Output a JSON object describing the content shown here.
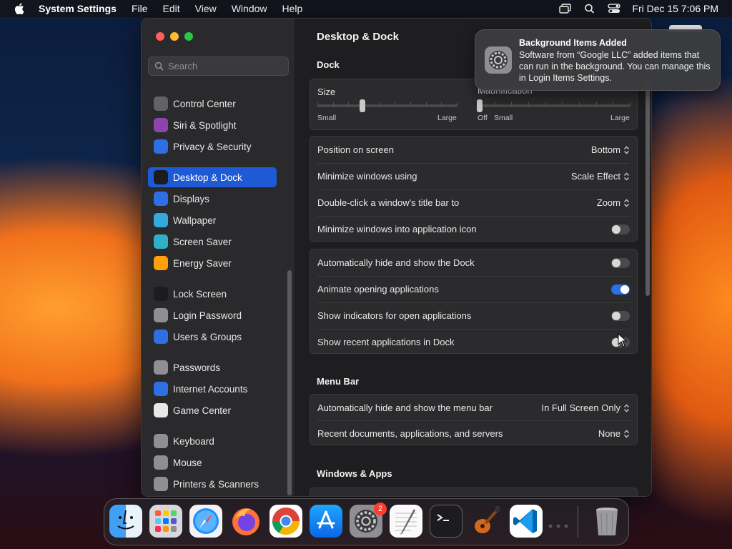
{
  "menubar": {
    "app_name": "System Settings",
    "menus": [
      "File",
      "Edit",
      "View",
      "Window",
      "Help"
    ],
    "clock": "Fri Dec 15  7:06 PM"
  },
  "sidebar": {
    "search_placeholder": "Search",
    "items": [
      {
        "label": "Control Center",
        "icon": "control-center-icon",
        "color": "#636366"
      },
      {
        "label": "Siri & Spotlight",
        "icon": "siri-icon",
        "color": "#8e44ad"
      },
      {
        "label": "Privacy & Security",
        "icon": "hand-icon",
        "color": "#2f6fe4"
      },
      {
        "label": "Desktop & Dock",
        "icon": "dock-icon",
        "color": "#1c1c1e",
        "active": true
      },
      {
        "label": "Displays",
        "icon": "sun-icon",
        "color": "#2f6fe4"
      },
      {
        "label": "Wallpaper",
        "icon": "flower-icon",
        "color": "#34aadc"
      },
      {
        "label": "Screen Saver",
        "icon": "screen-saver-icon",
        "color": "#30b0c7"
      },
      {
        "label": "Energy Saver",
        "icon": "bulb-icon",
        "color": "#ff9f0a"
      },
      {
        "label": "Lock Screen",
        "icon": "lock-icon",
        "color": "#1c1c1e"
      },
      {
        "label": "Login Password",
        "icon": "padlock-icon",
        "color": "#8e8e93"
      },
      {
        "label": "Users & Groups",
        "icon": "users-icon",
        "color": "#2f6fe4"
      },
      {
        "label": "Passwords",
        "icon": "key-icon",
        "color": "#8e8e93"
      },
      {
        "label": "Internet Accounts",
        "icon": "at-icon",
        "color": "#2f6fe4"
      },
      {
        "label": "Game Center",
        "icon": "game-center-icon",
        "color": "#e8e8e8"
      },
      {
        "label": "Keyboard",
        "icon": "keyboard-icon",
        "color": "#8e8e93"
      },
      {
        "label": "Mouse",
        "icon": "mouse-icon",
        "color": "#8e8e93"
      },
      {
        "label": "Printers & Scanners",
        "icon": "printer-icon",
        "color": "#8e8e93"
      }
    ]
  },
  "main": {
    "title": "Desktop & Dock",
    "dock_section": "Dock",
    "size_label": "Size",
    "size_small": "Small",
    "size_large": "Large",
    "size_level": 0.32,
    "magnification_label": "Magnification",
    "mag_off": "Off",
    "mag_small": "Small",
    "mag_large": "Large",
    "position": {
      "label": "Position on screen",
      "value": "Bottom"
    },
    "minimize": {
      "label": "Minimize windows using",
      "value": "Scale Effect"
    },
    "double_click": {
      "label": "Double-click a window's title bar to",
      "value": "Zoom"
    },
    "minimize_icon": {
      "label": "Minimize windows into application icon",
      "on": false
    },
    "auto_hide": {
      "label": "Automatically hide and show the Dock",
      "on": false
    },
    "animate": {
      "label": "Animate opening applications",
      "on": true
    },
    "indicators": {
      "label": "Show indicators for open applications",
      "on": false
    },
    "recent": {
      "label": "Show recent applications in Dock",
      "on": false
    },
    "menubar_section": "Menu Bar",
    "menubar_autohide": {
      "label": "Automatically hide and show the menu bar",
      "value": "In Full Screen Only"
    },
    "recent_docs": {
      "label": "Recent documents, applications, and servers",
      "value": "None"
    },
    "windows_section": "Windows & Apps"
  },
  "notification": {
    "title": "Background Items Added",
    "body": "Software from “Google LLC” added items that can run in the background. You can manage this in Login Items Settings."
  },
  "dock": {
    "settings_badge": "2",
    "apps": [
      "finder",
      "launchpad",
      "safari",
      "firefox",
      "chrome",
      "app-store",
      "system-settings",
      "textedit",
      "terminal",
      "garageband",
      "vscode"
    ]
  }
}
